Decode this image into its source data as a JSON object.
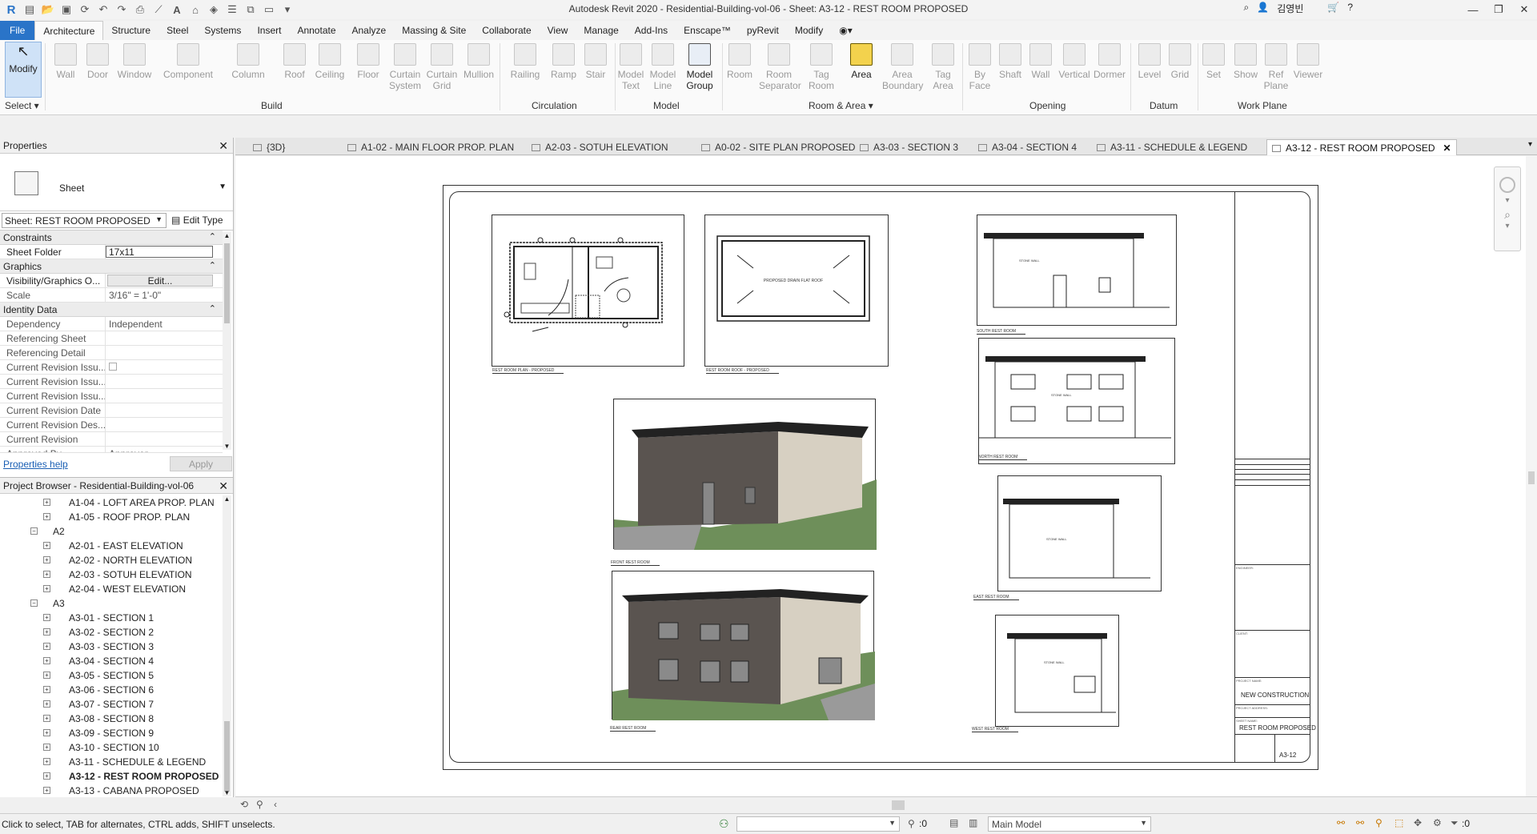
{
  "window": {
    "title": "Autodesk Revit 2020 - Residential-Building-vol-06 - Sheet: A3-12 - REST ROOM PROPOSED",
    "user": "김영빈"
  },
  "ribbon": {
    "tabs": [
      "File",
      "Architecture",
      "Structure",
      "Steel",
      "Systems",
      "Insert",
      "Annotate",
      "Analyze",
      "Massing & Site",
      "Collaborate",
      "View",
      "Manage",
      "Add-Ins",
      "Enscape™",
      "pyRevit",
      "Modify"
    ],
    "active_tab": "Architecture",
    "buttons": {
      "modify": "Modify",
      "wall": "Wall",
      "door": "Door",
      "window": "Window",
      "component": "Component",
      "column": "Column",
      "roof": "Roof",
      "ceiling": "Ceiling",
      "floor": "Floor",
      "curtain_system": "Curtain\nSystem",
      "curtain_grid": "Curtain\nGrid",
      "mullion": "Mullion",
      "railing": "Railing",
      "ramp": "Ramp",
      "stair": "Stair",
      "model_text": "Model\nText",
      "model_line": "Model\nLine",
      "model_group": "Model\nGroup",
      "room": "Room",
      "room_separator": "Room\nSeparator",
      "tag_room": "Tag\nRoom",
      "area": "Area",
      "area_boundary": "Area\nBoundary",
      "tag_area": "Tag\nArea",
      "by_face": "By\nFace",
      "shaft": "Shaft",
      "wall_opening": "Wall",
      "vertical": "Vertical",
      "dormer": "Dormer",
      "level": "Level",
      "grid": "Grid",
      "set": "Set",
      "show": "Show",
      "ref_plane": "Ref\nPlane",
      "viewer": "Viewer"
    },
    "panels": {
      "select": "Select ▾",
      "build": "Build",
      "circulation": "Circulation",
      "model": "Model",
      "room_area": "Room & Area ▾",
      "opening": "Opening",
      "datum": "Datum",
      "work_plane": "Work Plane"
    }
  },
  "properties": {
    "header": "Properties",
    "type_name": "Sheet",
    "selector": "Sheet: REST ROOM PROPOSED",
    "edit_type": "Edit Type",
    "groups": {
      "constraints": "Constraints",
      "graphics": "Graphics",
      "identity": "Identity Data"
    },
    "rows": {
      "sheet_folder": [
        "Sheet Folder",
        "17x11"
      ],
      "visibility": [
        "Visibility/Graphics O...",
        "Edit..."
      ],
      "scale": [
        "Scale",
        "3/16\" = 1'-0\""
      ],
      "dependency": [
        "Dependency",
        "Independent"
      ],
      "ref_sheet": [
        "Referencing Sheet",
        ""
      ],
      "ref_detail": [
        "Referencing Detail",
        ""
      ],
      "rev_issued": [
        "Current Revision Issu...",
        ""
      ],
      "rev_issued_by": [
        "Current Revision Issu...",
        ""
      ],
      "rev_issued_to": [
        "Current Revision Issu...",
        ""
      ],
      "rev_date": [
        "Current Revision Date",
        ""
      ],
      "rev_desc": [
        "Current Revision Des...",
        ""
      ],
      "rev": [
        "Current Revision",
        ""
      ],
      "approved_by": [
        "Approved By",
        "Approver"
      ]
    },
    "help": "Properties help",
    "apply": "Apply"
  },
  "browser": {
    "header": "Project Browser - Residential-Building-vol-06",
    "items": [
      {
        "label": "A1-04 - LOFT AREA PROP. PLAN",
        "level": 2
      },
      {
        "label": "A1-05 - ROOF PROP. PLAN",
        "level": 2
      },
      {
        "label": "A2",
        "level": 1
      },
      {
        "label": "A2-01 - EAST ELEVATION",
        "level": 2
      },
      {
        "label": "A2-02 - NORTH ELEVATION",
        "level": 2
      },
      {
        "label": "A2-03 - SOTUH ELEVATION",
        "level": 2
      },
      {
        "label": "A2-04 - WEST ELEVATION",
        "level": 2
      },
      {
        "label": "A3",
        "level": 1
      },
      {
        "label": "A3-01 - SECTION 1",
        "level": 2
      },
      {
        "label": "A3-02 - SECTION 2",
        "level": 2
      },
      {
        "label": "A3-03 - SECTION 3",
        "level": 2
      },
      {
        "label": "A3-04 - SECTION 4",
        "level": 2
      },
      {
        "label": "A3-05 - SECTION 5",
        "level": 2
      },
      {
        "label": "A3-06 - SECTION 6",
        "level": 2
      },
      {
        "label": "A3-07 - SECTION 7",
        "level": 2
      },
      {
        "label": "A3-08 - SECTION 8",
        "level": 2
      },
      {
        "label": "A3-09 - SECTION 9",
        "level": 2
      },
      {
        "label": "A3-10 - SECTION 10",
        "level": 2
      },
      {
        "label": "A3-11 - SCHEDULE & LEGEND",
        "level": 2
      },
      {
        "label": "A3-12 - REST ROOM PROPOSED",
        "level": 2,
        "selected": true
      },
      {
        "label": "A3-13 - CABANA PROPOSED",
        "level": 2
      }
    ]
  },
  "doc_tabs": [
    "{3D}",
    "A1-02 - MAIN FLOOR PROP. PLAN",
    "A2-03 - SOTUH ELEVATION",
    "A0-02 - SITE PLAN PROPOSED",
    "A3-03 - SECTION 3",
    "A3-04 - SECTION 4",
    "A3-11 - SCHEDULE & LEGEND",
    "A3-12 - REST ROOM PROPOSED"
  ],
  "sheet": {
    "viewports": {
      "plan": "REST ROOM PLAN - PROPOSED",
      "roof": "REST ROOM ROOF - PROPOSED",
      "south": "SOUTH REST ROOM",
      "north": "NORTH REST ROOM",
      "persp1": "FRONT REST ROOM",
      "persp2": "REAR REST ROOM",
      "east": "EAST REST ROOM",
      "west": "WEST REST ROOM",
      "roof_note": "PROPOSED DRAIN FLAT ROOF",
      "wall_note": "STONE WALL"
    },
    "titleblock": {
      "project_name_label": "PROJECT NAME:",
      "project_name": "NEW CONSTRUCTION",
      "project_address_label": "PROJECT ADDRESS:",
      "sheet_name_label": "SHEET NAME:",
      "sheet_name": "REST ROOM PROPOSED",
      "sheet_number": "A3-12",
      "engineer_label": "ENGINEER:",
      "client_label": "CLIENT:"
    }
  },
  "status": {
    "message": "Click to select, TAB for alternates, CTRL adds, SHIFT unselects.",
    "workset_value": ":0",
    "model": "Main Model",
    "filter_count": ":0"
  },
  "colors": {
    "accent": "#2a74c8",
    "brick": "#5a5450",
    "siding": "#d7d0c2",
    "grass": "#6e8f5a",
    "area_button": "#f3d24d"
  }
}
